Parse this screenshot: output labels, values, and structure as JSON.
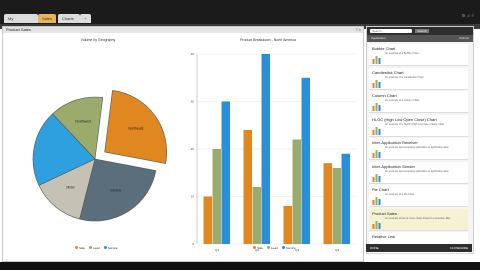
{
  "tabs": [
    {
      "label": "My Dashboards",
      "active": false
    },
    {
      "label": "Sales",
      "active": true
    },
    {
      "label": "Charts",
      "active": false
    },
    {
      "label": "+",
      "active": false
    }
  ],
  "panel": {
    "title": "Product Sales",
    "actions": "? ×"
  },
  "colors": {
    "accent": "#e8b455",
    "sale": "#e0871f",
    "lead": "#9bab6b",
    "service": "#2b8fd8",
    "pie_blue": "#2ea0e0",
    "pie_gray": "#c5c2b5",
    "pie_slate": "#5a6e7c"
  },
  "chart_data": [
    {
      "type": "pie",
      "title": "Volume by Geography",
      "slices": [
        {
          "label": "Northeast",
          "value": 26,
          "color": "#e0871f"
        },
        {
          "label": "Central",
          "value": 26,
          "color": "#5a6e7c"
        },
        {
          "label": "Midw",
          "value": 14,
          "color": "#c5c2b5"
        },
        {
          "label": "",
          "value": 20,
          "color": "#2ea0e0"
        },
        {
          "label": "Northwest",
          "value": 14,
          "color": "#9bab6b"
        }
      ],
      "legend": [
        "Sale",
        "Lead",
        "Service"
      ],
      "legend_position": "bottom"
    },
    {
      "type": "bar",
      "title": "Product Breakdown - North America",
      "categories": [
        "Q1",
        "Q2",
        "Q3",
        "Q4"
      ],
      "series": [
        {
          "name": "Sale",
          "values": [
            10,
            24,
            8,
            17
          ]
        },
        {
          "name": "Lead",
          "values": [
            20,
            12,
            22,
            16
          ]
        },
        {
          "name": "Service",
          "values": [
            30,
            40,
            35,
            19
          ]
        }
      ],
      "ylim": [
        0,
        40
      ],
      "yticks": [
        "0",
        "10",
        "20",
        "30",
        "40"
      ],
      "legend": [
        "Sale",
        "Lead",
        "Service"
      ],
      "legend_position": "bottom",
      "grid": true
    }
  ],
  "sidebar": {
    "search_placeholder": "Search",
    "search_button": "Search",
    "category_left": "Application",
    "category_right": "Actions",
    "items": [
      {
        "name": "Bubble Chart",
        "desc": "An example of a Bubble Chart",
        "icon": "bubble-chart-icon",
        "highlight": false
      },
      {
        "name": "Candlestick Chart",
        "desc": "An example of a Candlestick Chart",
        "icon": "candlestick-chart-icon",
        "highlight": false
      },
      {
        "name": "Column Chart",
        "desc": "An example of a Column Chart",
        "icon": "column-chart-icon",
        "highlight": false
      },
      {
        "name": "HLOC (High Low Open Close) Chart",
        "desc": "An example of a HLOC (High Low Open Close) Chart",
        "icon": "hloc-chart-icon",
        "highlight": false
      },
      {
        "name": "Inter-Application Receiver",
        "desc": "An example demonstrating application to application data",
        "icon": "receiver-icon",
        "highlight": false
      },
      {
        "name": "Inter-Application Sender",
        "desc": "An example demonstrating application to application data",
        "icon": "sender-icon",
        "highlight": false
      },
      {
        "name": "Pie Chart",
        "desc": "An example of a Pie Chart",
        "icon": "pie-chart-icon",
        "highlight": false
      },
      {
        "name": "Product Sales",
        "desc": "An example of two or more charts linked to a selection filter",
        "icon": "product-sales-icon",
        "highlight": true
      },
      {
        "name": "Relative Link",
        "desc": "",
        "icon": "link-icon",
        "highlight": false
      }
    ],
    "footer_left": "DONE",
    "footer_right": "CLOSE/HIDE"
  }
}
